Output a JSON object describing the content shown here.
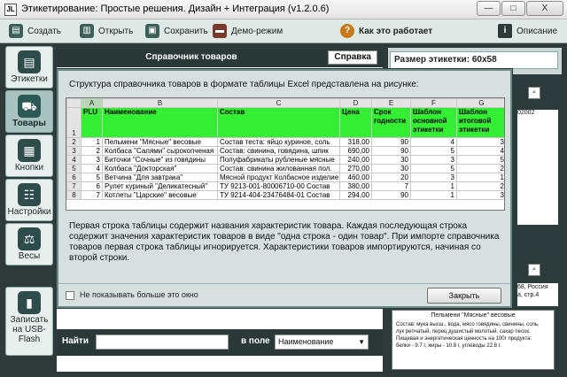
{
  "window": {
    "title": "Этикетирование: Простые решения. Дизайн + Интеграция (v1.2.0.6)",
    "app_icon_text": "JL",
    "minimize": "—",
    "maximize": "□",
    "close": "X"
  },
  "toolbar": {
    "create": "Создать",
    "open": "Открыть",
    "save": "Сохранить",
    "demo": "Демо-режим",
    "how_it_works": "Как это работает",
    "description": "Описание"
  },
  "sidebar": {
    "labels": "Этикетки",
    "goods": "Товары",
    "buttons": "Кнопки",
    "settings": "Настройки",
    "scales": "Весы",
    "usb": "Записать на USB-Flash"
  },
  "panel": {
    "title": "Справочник товаров",
    "help_button": "Справка"
  },
  "search": {
    "find_label": "Найти",
    "in_field_label": "в поле",
    "field_value": "Наименование"
  },
  "right": {
    "size_label": "Размер этикетки:  60x58",
    "peek_top": "02002",
    "peek_mid1": "68, Россия",
    "peek_mid2": "а, стр.4"
  },
  "preview": {
    "title": "Пельмени \"Мясные\" весовые",
    "line1": "Состав: мука высш., вода, мясо говядины, свинины, соль,",
    "line2": "лук репчатый, перец душистый молотый, сахар песок.",
    "line3": "Пищевая и энергетическая ценность на 100г продукта:",
    "line4": "белки - 9.7 г, жиры - 10.8 г, углеводы 22.8 г."
  },
  "dialog": {
    "heading": "Структура справочника товаров в формате таблицы Excel представлена на рисунке:",
    "sheet": {
      "columns": [
        "A",
        "B",
        "C",
        "D",
        "E",
        "F",
        "G"
      ],
      "headers": [
        "PLU",
        "Наименование",
        "Состав",
        "Цена",
        "Срок годности",
        "Шаблон основной этикетки",
        "Шаблон итоговой этикетки"
      ],
      "rows": [
        [
          "2",
          "1",
          "Пельмени \"Мясные\" весовые",
          "Состав теста: яйцо куриное, соль",
          "318,00",
          "90",
          "4",
          "3"
        ],
        [
          "3",
          "2",
          "Колбаса \"Салями\" сырокопченая",
          "Состав: свинина, говядина, шпик",
          "690,00",
          "90",
          "5",
          "4"
        ],
        [
          "4",
          "3",
          "Биточки \"Сочные\" из говядины",
          "Полуфабрикаты рубленые мясные",
          "240,00",
          "30",
          "3",
          "5"
        ],
        [
          "5",
          "4",
          "Колбаса \"Докторская\"",
          "Состав: свинина жилованная пол.",
          "270,00",
          "30",
          "5",
          "2"
        ],
        [
          "6",
          "5",
          "Ветчина \"Для завтрака\"",
          "Мясной продукт Колбасное изделие",
          "460,00",
          "20",
          "3",
          "1"
        ],
        [
          "7",
          "6",
          "Рулет куриный \"Деликатесный\"",
          "ТУ 9213-001-80006710-00 Состав",
          "380,00",
          "7",
          "1",
          "2"
        ],
        [
          "8",
          "7",
          "Котлеты \"Царские\" весовые",
          "ТУ 9214-404-23476484-01 Состав",
          "294,00",
          "90",
          "1",
          "3"
        ]
      ],
      "header_row_no": "1"
    },
    "text": "Первая строка таблицы содержит названия характеристик товара. Каждая последующая строка содержит значения характеристик товаров в виде \"одна строка - один товар\". При импорте справочника товаров первая строка таблицы игнорируется. Характеристики товаров импортируются, начиная со второй строки.",
    "checkbox_label": "Не показывать больше это окно",
    "close_button": "Закрыть"
  }
}
